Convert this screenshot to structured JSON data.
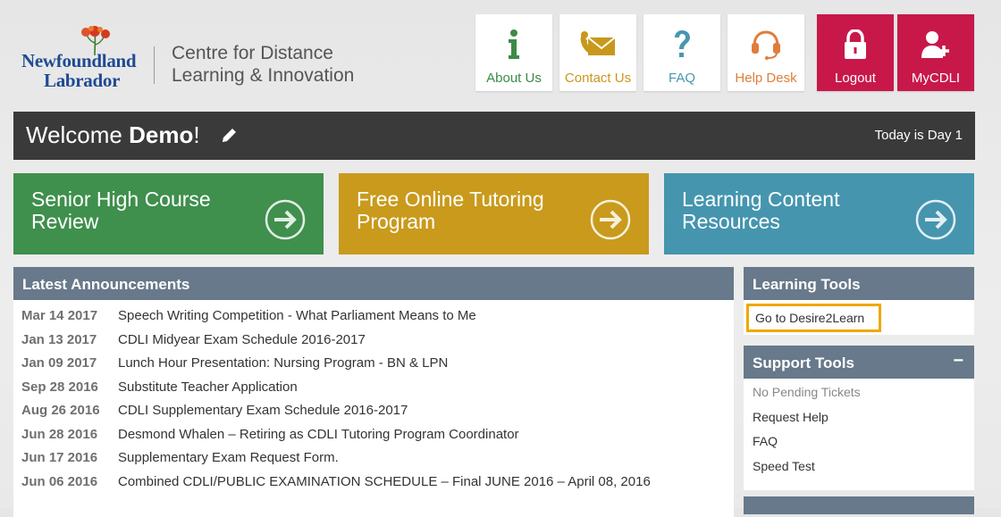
{
  "brand": {
    "logo_line1": "Newfoundland",
    "logo_line2": "Labrador",
    "centre_line1": "Centre for Distance",
    "centre_line2": "Learning & Innovation"
  },
  "top_nav": {
    "about": "About Us",
    "contact": "Contact Us",
    "faq": "FAQ",
    "help": "Help Desk",
    "logout": "Logout",
    "mycdli": "MyCDLI"
  },
  "welcome": {
    "prefix": "Welcome ",
    "name": "Demo",
    "suffix": "!",
    "day": "Today is Day 1"
  },
  "tiles": [
    {
      "label": "Senior High Course Review"
    },
    {
      "label": "Free Online Tutoring Program"
    },
    {
      "label": "Learning Content Resources"
    }
  ],
  "announcements": {
    "heading": "Latest Announcements",
    "items": [
      {
        "date": "Mar 14 2017",
        "title": "Speech Writing Competition - What Parliament Means to Me"
      },
      {
        "date": "Jan 13 2017",
        "title": "CDLI Midyear Exam Schedule 2016-2017"
      },
      {
        "date": "Jan 09 2017",
        "title": "Lunch Hour Presentation: Nursing Program - BN & LPN"
      },
      {
        "date": "Sep 28 2016",
        "title": "Substitute Teacher Application"
      },
      {
        "date": "Aug 26 2016",
        "title": "CDLI Supplementary Exam Schedule 2016-2017"
      },
      {
        "date": "Jun 28 2016",
        "title": "Desmond Whalen – Retiring as CDLI Tutoring Program Coordinator"
      },
      {
        "date": "Jun 17 2016",
        "title": "Supplementary Exam Request Form."
      },
      {
        "date": "Jun 06 2016",
        "title": "Combined CDLI/PUBLIC EXAMINATION SCHEDULE – Final JUNE 2016 – April 08, 2016"
      }
    ]
  },
  "learning_tools": {
    "heading": "Learning Tools",
    "link": "Go to Desire2Learn"
  },
  "support_tools": {
    "heading": "Support Tools",
    "collapse": "−",
    "items": [
      "No Pending Tickets",
      "Request Help",
      "FAQ",
      "Speed Test"
    ]
  },
  "colors": {
    "accent_red": "#c8184a",
    "green": "#3f8f4d",
    "gold": "#c99a1c",
    "teal": "#4595af",
    "panel_header": "#67798a",
    "highlight_border": "#f0a800"
  }
}
